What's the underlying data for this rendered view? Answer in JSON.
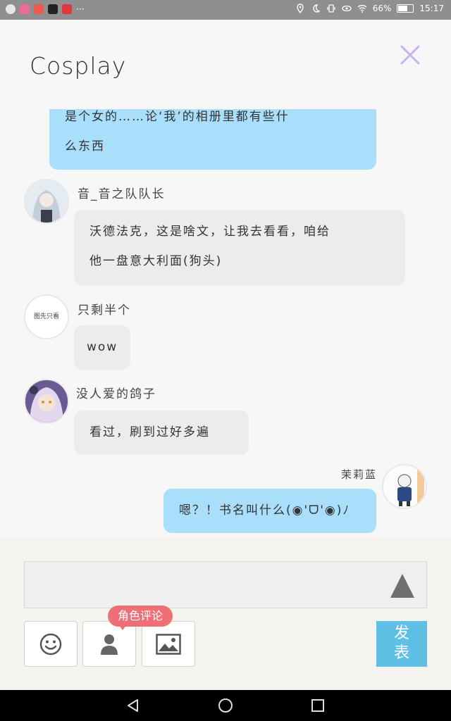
{
  "status_bar": {
    "battery": "66%",
    "time": "15:17",
    "more": "···",
    "battery_level": 0.66
  },
  "header": {
    "title": "Cosplay"
  },
  "messages": [
    {
      "text_line1": "是个女的……论‘我’的相册里都有些什",
      "text_line2": "么东西"
    },
    {
      "user": "音_音之队队长",
      "text_line1": "沃德法克，这是啥文，让我去看看，咱给",
      "text_line2": "他一盘意大利面(狗头)"
    },
    {
      "user": "只剩半个",
      "avatar_text": "图先只看",
      "text": "wow"
    },
    {
      "user": "没人爱的鸽子",
      "text": "看过，刷到过好多遍"
    },
    {
      "user": "茉莉蓝",
      "text": "嗯？！书名叫什么(◉'ᗜ'◉)ﾉ"
    }
  ],
  "composer": {
    "placeholder": "",
    "tooltip": "角色评论",
    "post_label": "发表"
  },
  "colors": {
    "bubble_blue": "#a9dffb",
    "bubble_gray": "#ececec",
    "post_button": "#5ec0e4",
    "tooltip": "#ee6f76",
    "close_icon": "#c9b3ee"
  }
}
